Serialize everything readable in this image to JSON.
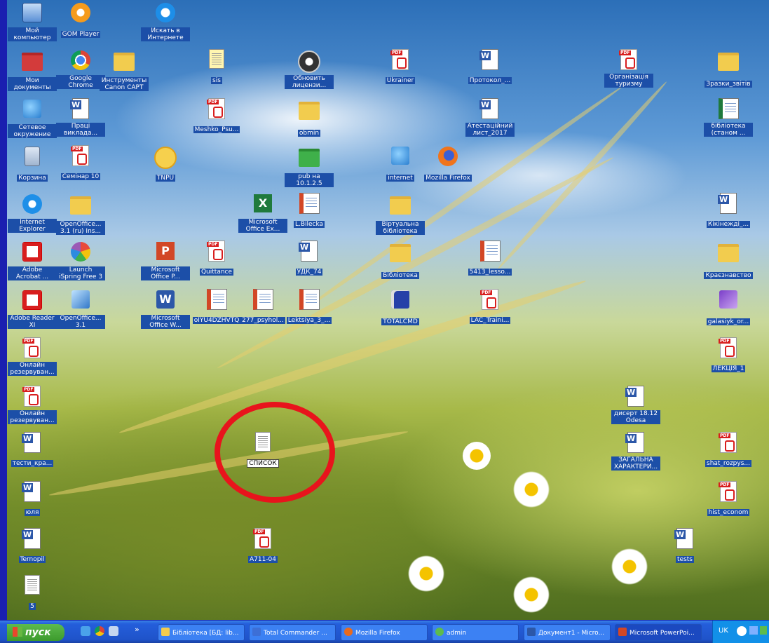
{
  "desktop_icons": [
    {
      "label": "Мой компьютер",
      "kind": "computer"
    },
    {
      "label": "GOM Player",
      "kind": "gom"
    },
    {
      "label": "Искать в Интернете",
      "kind": "search"
    },
    {
      "label": "Мои документы",
      "kind": "folder-red"
    },
    {
      "label": "Google Chrome",
      "kind": "chrome"
    },
    {
      "label": "Инструменты Canon CAPT",
      "kind": "folder"
    },
    {
      "label": "sis",
      "kind": "help"
    },
    {
      "label": "Обновить лицензи...",
      "kind": "update"
    },
    {
      "label": "Ukrainer",
      "kind": "pdf"
    },
    {
      "label": "Протокол_...",
      "kind": "word-doc"
    },
    {
      "label": "Організація туризму",
      "kind": "pdf"
    },
    {
      "label": "Зразки_звітів",
      "kind": "folder"
    },
    {
      "label": "Сетевое окружение",
      "kind": "network"
    },
    {
      "label": "Праці виклада...",
      "kind": "word-doc"
    },
    {
      "label": "Meshko_Psu...",
      "kind": "pdf"
    },
    {
      "label": "obmin",
      "kind": "folder"
    },
    {
      "label": "Атестаційний лист_2017",
      "kind": "word-doc"
    },
    {
      "label": "бібліотека (станом ...",
      "kind": "excel-doc"
    },
    {
      "label": "Корзина",
      "kind": "recycle"
    },
    {
      "label": "Семінар 10",
      "kind": "pdf"
    },
    {
      "label": "TNPU",
      "kind": "onec"
    },
    {
      "label": "pub на 10.1.2.5",
      "kind": "folder-green"
    },
    {
      "label": "internet",
      "kind": "network"
    },
    {
      "label": "Mozilla Firefox",
      "kind": "firefox"
    },
    {
      "label": "Internet Explorer",
      "kind": "ie"
    },
    {
      "label": "OpenOffice... 3.1 (ru) Ins...",
      "kind": "folder"
    },
    {
      "label": "Microsoft Office Ex...",
      "kind": "excel"
    },
    {
      "label": "L.Bilecka",
      "kind": "ppt-doc"
    },
    {
      "label": "Віртуальна бібліотека",
      "kind": "folder"
    },
    {
      "label": "Кікінежді_...",
      "kind": "word-doc"
    },
    {
      "label": "Adobe Acrobat ...",
      "kind": "acrobat"
    },
    {
      "label": "Launch iSpring Free 3",
      "kind": "ispring"
    },
    {
      "label": "Microsoft Office P...",
      "kind": "ppt"
    },
    {
      "label": "Quittance",
      "kind": "pdf"
    },
    {
      "label": "УДК_74",
      "kind": "word-doc"
    },
    {
      "label": "Бібліотека",
      "kind": "folder"
    },
    {
      "label": "5413_lesso...",
      "kind": "ppt-doc"
    },
    {
      "label": "Краєзнавство",
      "kind": "folder"
    },
    {
      "label": "Adobe Reader XI",
      "kind": "acrobat"
    },
    {
      "label": "OpenOffice... 3.1",
      "kind": "openoffice"
    },
    {
      "label": "Microsoft Office W...",
      "kind": "word"
    },
    {
      "label": "oIYU4DZHVTQ",
      "kind": "ppt-doc"
    },
    {
      "label": "277_psyhol...",
      "kind": "ppt-doc"
    },
    {
      "label": "Lektsiya_3_...",
      "kind": "ppt-doc"
    },
    {
      "label": "TOTALCMD",
      "kind": "floppy"
    },
    {
      "label": "LAC_Traini...",
      "kind": "pdf"
    },
    {
      "label": "galasiyk_or...",
      "kind": "purple"
    },
    {
      "label": "Онлайн резервуван...",
      "kind": "pdf"
    },
    {
      "label": "ЛЕКЦІЯ_1",
      "kind": "pdf"
    },
    {
      "label": "Онлайн резервуван...",
      "kind": "pdf"
    },
    {
      "label": "дисерт 18.12 Odesa",
      "kind": "word-doc"
    },
    {
      "label": "тести_кра...",
      "kind": "word-doc"
    },
    {
      "label": "СПИСОК",
      "kind": "txt"
    },
    {
      "label": "ЗАГАЛЬНА ХАРАКТЕРИ...",
      "kind": "word-doc"
    },
    {
      "label": "shat_rozpys...",
      "kind": "pdf"
    },
    {
      "label": "юля",
      "kind": "word-doc"
    },
    {
      "label": "hist_econom",
      "kind": "pdf"
    },
    {
      "label": "Ternopil",
      "kind": "word-doc"
    },
    {
      "label": "A711-04",
      "kind": "pdf"
    },
    {
      "label": "tests",
      "kind": "word-doc"
    },
    {
      "label": "5",
      "kind": "txt"
    }
  ],
  "taskbar": {
    "start_label": "пуск",
    "chevron": "»",
    "tasks": [
      {
        "label": "Бібліотека [БД: lib...",
        "color": "#f2cc4e"
      },
      {
        "label": "Total Commander ...",
        "color": "#3d6fd6"
      },
      {
        "label": "Mozilla Firefox",
        "color": "#e86a1e"
      },
      {
        "label": "admin",
        "color": "#5dbb4d"
      },
      {
        "label": "Документ1 - Micro...",
        "color": "#2c57a8"
      },
      {
        "label": "Microsoft PowerPoi...",
        "color": "#d24726"
      }
    ],
    "language": "UK"
  },
  "colors": {
    "frame": "#1a1fb0",
    "label_bg": "#1c4fa8",
    "highlight": "#e8141c",
    "taskbar": "#245edb",
    "start": "#3c9a2c"
  }
}
